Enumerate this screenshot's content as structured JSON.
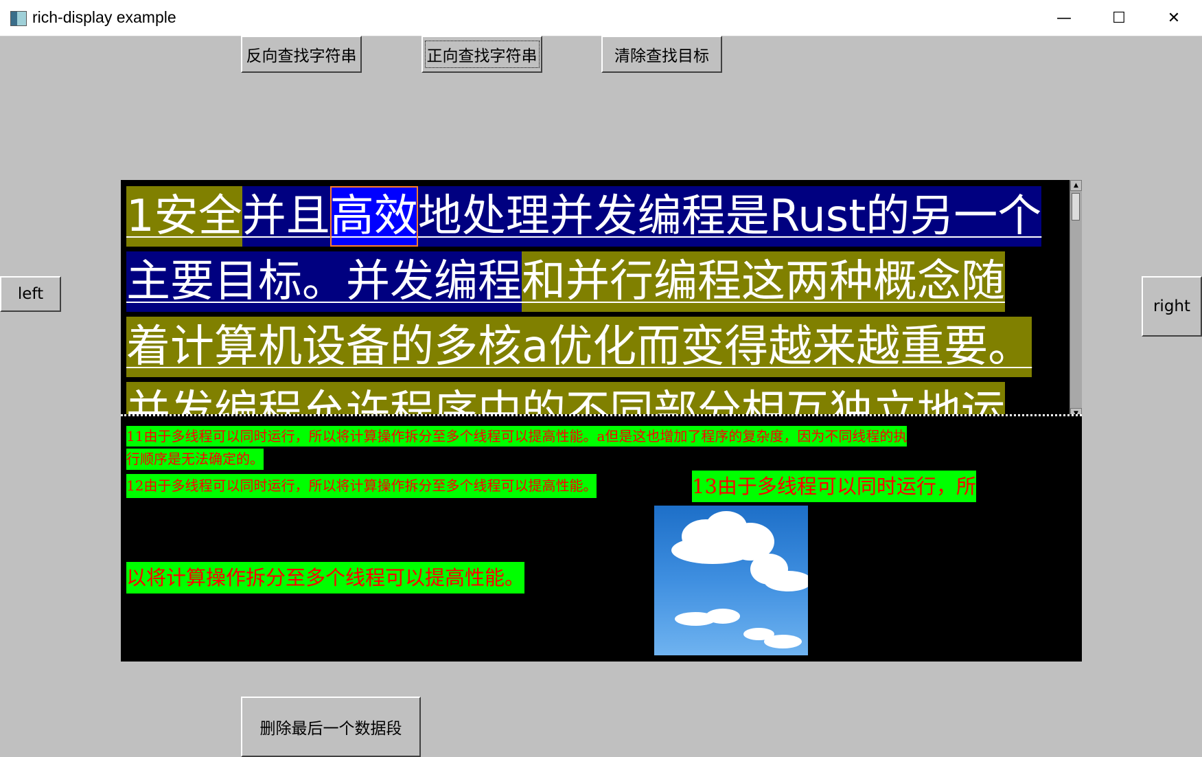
{
  "window": {
    "title": "rich-display example",
    "minimize": "—",
    "maximize": "☐",
    "close": "✕"
  },
  "toolbar": {
    "reverse_find": "反向查找字符串",
    "forward_find": "正向查找字符串",
    "clear_find": "清除查找目标"
  },
  "side": {
    "left": "left",
    "right": "right"
  },
  "footer": {
    "delete_last": "删除最后一个数据段"
  },
  "top_pane": {
    "line1": {
      "seg1": "1安全",
      "seg2": "并且",
      "seg3": "高效",
      "seg4": "地处理并发编程是Rust的另一个"
    },
    "line2": {
      "seg1": "主要目标。并发编程",
      "seg2": "和并行编程这两种概念随"
    },
    "line3": {
      "seg1": "着计算机设备的多核a优化而变得越来越重要。"
    },
    "line4": {
      "seg1": "并发编程允许程序中的不同部分相互独立地运"
    }
  },
  "bottom_pane": {
    "p11a": "11由于多线程可以同时运行，所以将计算操作拆分至多个线程可以提高性能。a但是这也增加了程序的复杂度，因为不同线程的执",
    "p11b": "行顺序是无法确定的。",
    "p12": "12由于多线程可以同时运行，所以将计算操作拆分至多个线程可以提高性能。",
    "p13a": "13由于多线程可以同时运行，所",
    "p13b": "以将计算操作拆分至多个线程可以提高性能。"
  },
  "colors": {
    "window_bg": "#c0c0c0",
    "olive": "#808000",
    "navy": "#000080",
    "selection": "#0000ff",
    "green_bg": "#00ff00",
    "red_text": "#ff0000"
  },
  "image": {
    "description_icon": "sky-clouds-image"
  }
}
